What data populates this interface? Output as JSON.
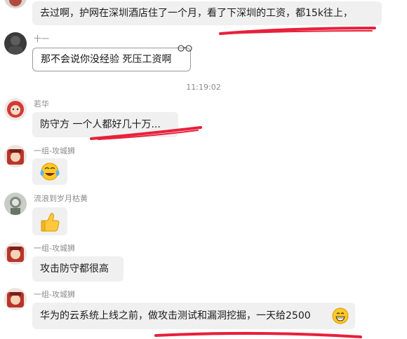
{
  "messages": [
    {
      "id": "m1",
      "sender": "",
      "text": "去过啊，护网在深圳酒店住了一个月，看了下深圳的工资，都15k往上，"
    },
    {
      "id": "m2",
      "sender": "十一",
      "text": "那不会说你没经验 死压工资啊"
    },
    {
      "id": "m3",
      "sender": "若华",
      "text": "防守方  一个人都好几十万..."
    },
    {
      "id": "m4",
      "sender": "一组-攻城狮",
      "emoji": "laughing-tears-emoji"
    },
    {
      "id": "m5",
      "sender": "流浪到岁月枯黄",
      "emoji": "thumbs-up-emoji"
    },
    {
      "id": "m6",
      "sender": "一组-攻城狮",
      "text": "攻击防守都很高"
    },
    {
      "id": "m7",
      "sender": "一组-攻城狮",
      "text": "华为的云系统上线之前，做攻击测试和漏洞挖掘，一天给2500",
      "trailing_emoji": "grin-emoji"
    }
  ],
  "timestamp": "11:19:02",
  "colors": {
    "bubble": "#f0f0f0",
    "underline": "#e8203a",
    "meta_text": "#8a8a8a"
  }
}
